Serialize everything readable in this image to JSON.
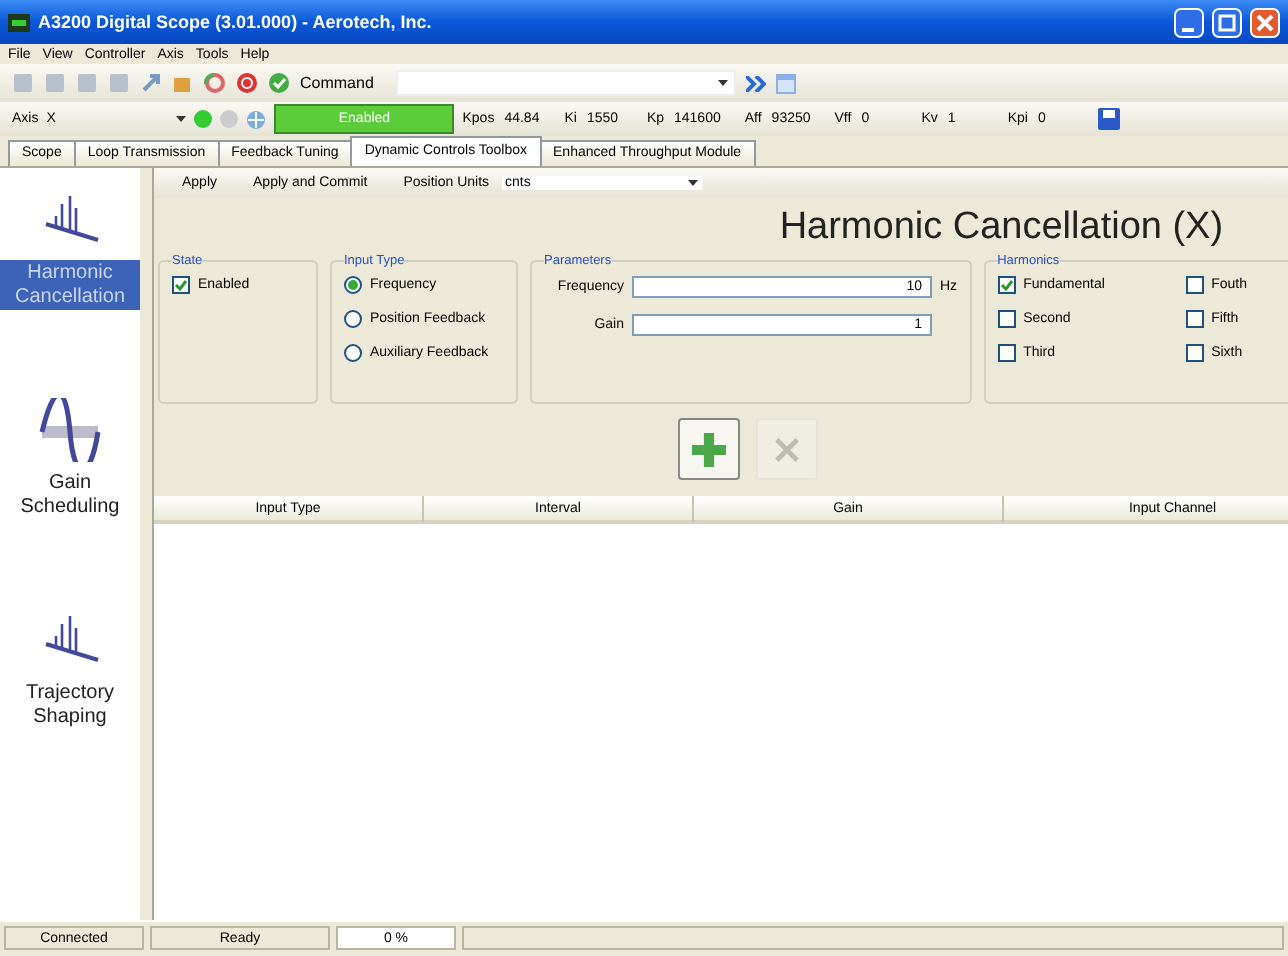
{
  "window": {
    "title": "A3200 Digital Scope (3.01.000) - Aerotech, Inc."
  },
  "menu": [
    "File",
    "View",
    "Controller",
    "Axis",
    "Tools",
    "Help"
  ],
  "toolbar": {
    "command_label": "Command"
  },
  "axis_bar": {
    "axis_label": "Axis",
    "axis_value": "X",
    "status": "Enabled",
    "readings": [
      {
        "label": "Kpos",
        "value": "44.84"
      },
      {
        "label": "Ki",
        "value": "1550"
      },
      {
        "label": "Kp",
        "value": "141600"
      },
      {
        "label": "Aff",
        "value": "93250"
      },
      {
        "label": "Vff",
        "value": "0"
      },
      {
        "label": "Kv",
        "value": "1"
      },
      {
        "label": "Kpi",
        "value": "0"
      }
    ]
  },
  "tabs": [
    {
      "label": "Scope",
      "selected": false
    },
    {
      "label": "Loop Transmission",
      "selected": false
    },
    {
      "label": "Feedback Tuning",
      "selected": false
    },
    {
      "label": "Dynamic Controls Toolbox",
      "selected": true
    },
    {
      "label": "Enhanced Throughput Module",
      "selected": false
    }
  ],
  "sidebar": {
    "items": [
      {
        "label": "Harmonic Cancellation",
        "kind": "spikes",
        "selected": true
      },
      {
        "label": "Gain Scheduling",
        "kind": "sine",
        "selected": false
      },
      {
        "label": "Trajectory Shaping",
        "kind": "spikes",
        "selected": false
      }
    ]
  },
  "command_bar": {
    "actions": [
      "Apply",
      "Apply and Commit"
    ],
    "units_label": "Position Units",
    "units_value": "cnts"
  },
  "panel": {
    "title": "Harmonic Cancellation (X)",
    "state": {
      "title": "State",
      "checkbox": {
        "label": "Enabled",
        "checked": true
      }
    },
    "input_type": {
      "title": "Input Type",
      "options": [
        {
          "label": "Frequency",
          "selected": true
        },
        {
          "label": "Position Feedback",
          "selected": false
        },
        {
          "label": "Auxiliary Feedback",
          "selected": false
        }
      ]
    },
    "parameters": {
      "title": "Parameters",
      "fields": [
        {
          "label": "Frequency",
          "value": "10",
          "unit": "Hz"
        },
        {
          "label": "Gain",
          "value": "1"
        }
      ]
    },
    "harmonics": {
      "title": "Harmonics",
      "items": [
        {
          "label": "Fundamental",
          "checked": true
        },
        {
          "label": "Second",
          "checked": false
        },
        {
          "label": "Third",
          "checked": false
        },
        {
          "label": "Fouth",
          "checked": false
        },
        {
          "label": "Fifth",
          "checked": false
        },
        {
          "label": "Sixth",
          "checked": false
        }
      ]
    },
    "buttons": [
      {
        "kind": "add",
        "disabled": false
      },
      {
        "kind": "delete",
        "disabled": true
      }
    ]
  },
  "table": {
    "columns": [
      "Input Type",
      "Interval",
      "Gain",
      "Input Channel"
    ]
  },
  "status_bar": [
    "Connected",
    "Ready",
    "0 %"
  ]
}
